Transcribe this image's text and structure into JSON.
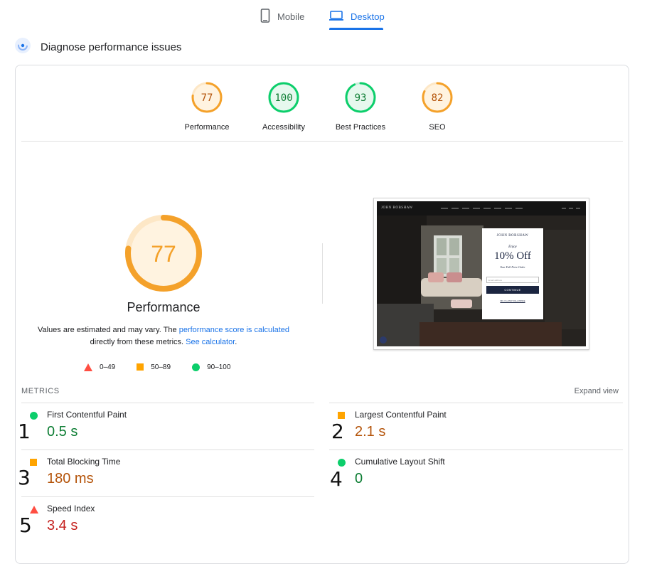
{
  "tabs": {
    "mobile": "Mobile",
    "desktop": "Desktop"
  },
  "diagnose": {
    "title": "Diagnose performance issues"
  },
  "gauges": [
    {
      "score": "77",
      "label": "Performance",
      "color": "#f4a12a",
      "fraction": 0.77
    },
    {
      "score": "100",
      "label": "Accessibility",
      "color": "#0cce6b",
      "fraction": 1.0
    },
    {
      "score": "93",
      "label": "Best Practices",
      "color": "#0cce6b",
      "fraction": 0.93
    },
    {
      "score": "82",
      "label": "SEO",
      "color": "#f4a12a",
      "fraction": 0.82
    }
  ],
  "performance": {
    "score": "77",
    "fraction": 0.77,
    "title": "Performance",
    "note_prefix": "Values are estimated and may vary. The ",
    "note_link": "performance score is calculated",
    "note_middle": "directly from these metrics. ",
    "note_link2": "See calculator",
    "note_end": "."
  },
  "legend": {
    "fail": "0–49",
    "average": "50–89",
    "pass": "90–100"
  },
  "screenshot": {
    "brand": "JOHN ROBSHAW",
    "modal_brand": "JOHN ROBSHAW",
    "enjoy": "Enjoy",
    "offer": "10% Off",
    "full_price": "Your Full Price Order",
    "email_placeholder": "Email address",
    "continue": "CONTINUE",
    "no_thanks": "NO, I'LL PAY FULL PRICE"
  },
  "metrics": {
    "header": "METRICS",
    "expand": "Expand view",
    "items": [
      {
        "name": "First Contentful Paint",
        "value": "0.5 s",
        "rating": "pass",
        "hand": "1"
      },
      {
        "name": "Largest Contentful Paint",
        "value": "2.1 s",
        "rating": "average",
        "hand": "2"
      },
      {
        "name": "Total Blocking Time",
        "value": "180 ms",
        "rating": "average",
        "hand": "3"
      },
      {
        "name": "Cumulative Layout Shift",
        "value": "0",
        "rating": "pass",
        "hand": "4"
      },
      {
        "name": "Speed Index",
        "value": "3.4 s",
        "rating": "fail",
        "hand": "5"
      }
    ]
  },
  "colors": {
    "accent": "#1a73e8",
    "pass": "#0cce6b",
    "average": "#ffa400",
    "fail": "#ff4e42"
  }
}
